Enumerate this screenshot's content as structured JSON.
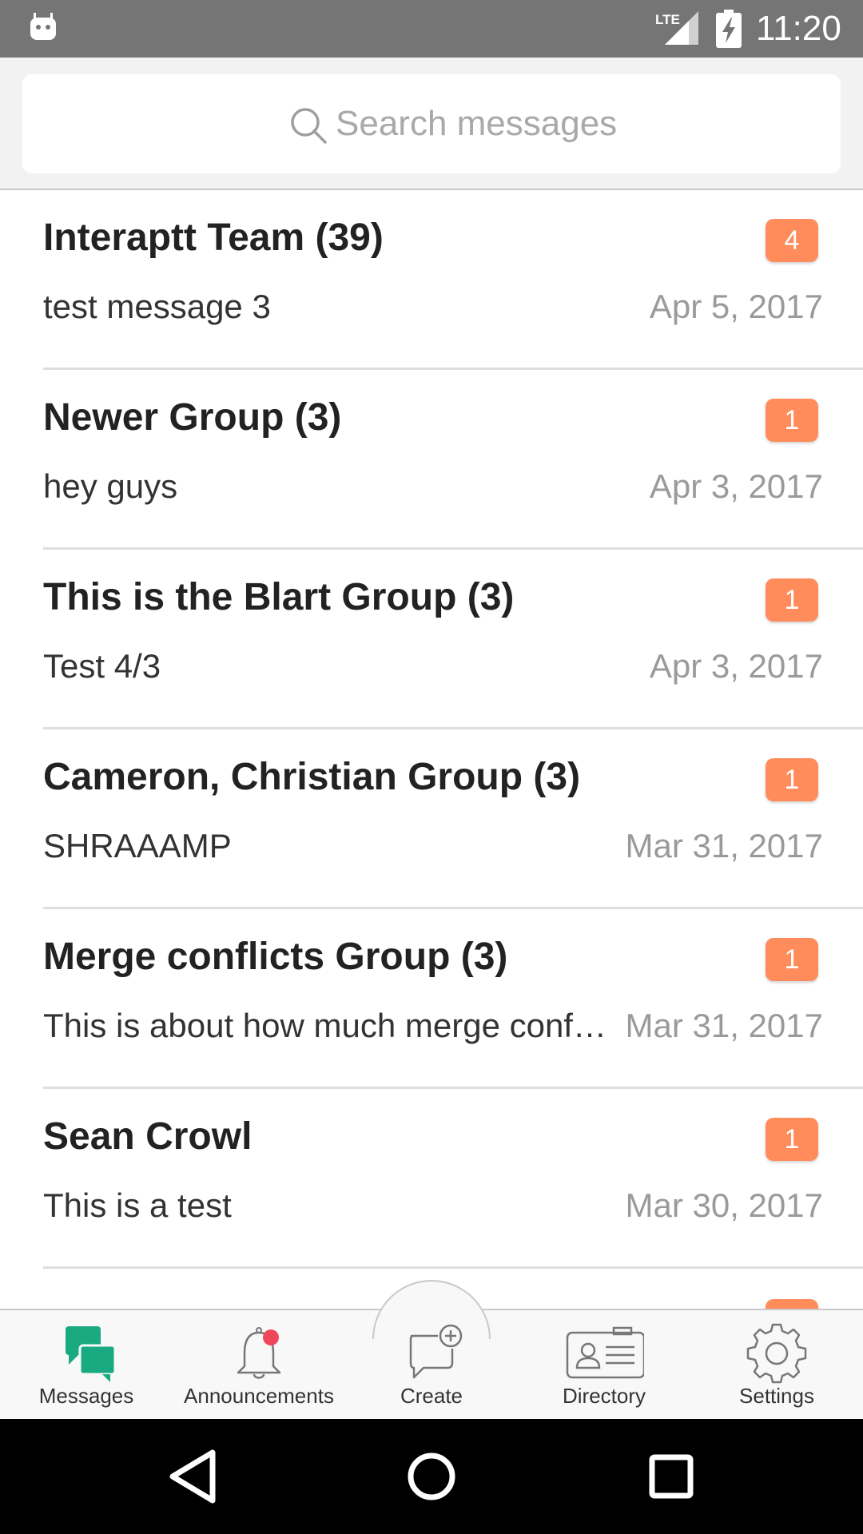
{
  "status_bar": {
    "time": "11:20",
    "network": "LTE",
    "icons": [
      "android-debug-icon",
      "lte-signal-icon",
      "battery-charging-icon"
    ]
  },
  "search": {
    "placeholder": "Search messages",
    "icon": "search-icon"
  },
  "conversations": [
    {
      "title": "Interaptt Team (39)",
      "preview": "test message 3",
      "date": "Apr 5, 2017",
      "unread": "4"
    },
    {
      "title": "Newer Group (3)",
      "preview": "hey guys",
      "date": "Apr 3, 2017",
      "unread": "1"
    },
    {
      "title": "This is the Blart Group (3)",
      "preview": "Test 4/3",
      "date": "Apr 3, 2017",
      "unread": "1"
    },
    {
      "title": "Cameron, Christian Group (3)",
      "preview": "SHRAAAMP",
      "date": "Mar 31, 2017",
      "unread": "1"
    },
    {
      "title": "Merge conflicts Group (3)",
      "preview": "This is about how much merge conflicts",
      "date": "Mar 31, 2017",
      "unread": "1"
    },
    {
      "title": "Sean Crowl",
      "preview": "This is a test",
      "date": "Mar 30, 2017",
      "unread": "1"
    }
  ],
  "tabs": [
    {
      "label": "Messages",
      "icon": "messages-icon",
      "active": true
    },
    {
      "label": "Announcements",
      "icon": "bell-icon",
      "active": false
    },
    {
      "label": "Create",
      "icon": "create-message-icon",
      "active": false
    },
    {
      "label": "Directory",
      "icon": "id-card-icon",
      "active": false
    },
    {
      "label": "Settings",
      "icon": "gear-icon",
      "active": false
    }
  ],
  "nav_bar": {
    "icons": [
      "back-icon",
      "home-icon",
      "recents-icon"
    ]
  },
  "colors": {
    "status_bar": "#757575",
    "accent_badge": "#ff8c5a",
    "active_tab": "#1aaa82",
    "notification_dot": "#f0465a"
  }
}
